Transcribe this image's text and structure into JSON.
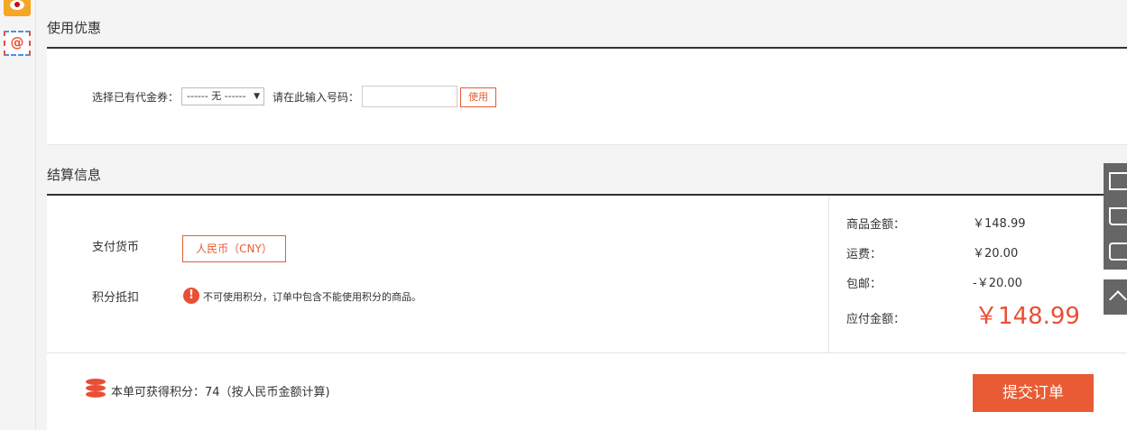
{
  "coupon": {
    "section_title": "使用优惠",
    "select_label": "选择已有代金券：",
    "select_value": "------ 无 ------",
    "code_label": "请在此输入号码：",
    "code_value": "",
    "use_button": "使用"
  },
  "settlement": {
    "section_title": "结算信息",
    "currency_label": "支付货币",
    "currency_option": "人民币（CNY）",
    "points_label": "积分抵扣",
    "points_message": "不可使用积分，订单中包含不能使用积分的商品。",
    "summary": {
      "goods_label": "商品金额：",
      "goods_value": "￥148.99",
      "shipping_label": "运费：",
      "shipping_value": "￥20.00",
      "free_shipping_label": "包邮：",
      "free_shipping_value": "-￥20.00",
      "total_label": "应付金额：",
      "total_value": "￥148.99"
    }
  },
  "bottom": {
    "earn_points_text": "本单可获得积分：74（按人民币金额计算)",
    "submit_button": "提交订单"
  },
  "colors": {
    "accent": "#e85b34",
    "price": "#e94f36",
    "toolbar": "#666666"
  },
  "icons": [
    "weibo-share-icon",
    "mail-share-icon",
    "warning-icon",
    "coins-icon",
    "checklist-icon",
    "cart-icon",
    "device-icon",
    "back-to-top-icon"
  ]
}
